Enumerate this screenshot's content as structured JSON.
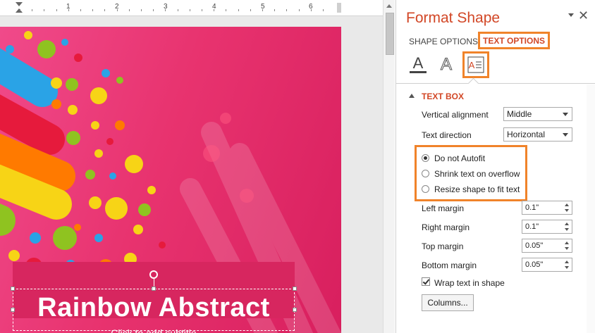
{
  "ruler": {
    "numbers": [
      "1",
      "2",
      "3",
      "4",
      "5",
      "6"
    ]
  },
  "slide": {
    "title": "Rainbow Abstract",
    "subtitle": "Click to add subtitle"
  },
  "pane": {
    "title": "Format Shape",
    "tabs": {
      "shape_options": "SHAPE OPTIONS",
      "text_options": "TEXT OPTIONS"
    },
    "icons": [
      "text-fill-outline-icon",
      "text-effects-icon",
      "textbox-icon"
    ],
    "section": "TEXT BOX",
    "vertical_alignment": {
      "label": "Vertical alignment",
      "value": "Middle"
    },
    "text_direction": {
      "label": "Text direction",
      "value": "Horizontal"
    },
    "autofit": {
      "options": [
        "Do not Autofit",
        "Shrink text on overflow",
        "Resize shape to fit text"
      ],
      "selected": "Do not Autofit"
    },
    "margins": {
      "left": {
        "label": "Left margin",
        "value": "0.1\""
      },
      "right": {
        "label": "Right margin",
        "value": "0.1\""
      },
      "top": {
        "label": "Top margin",
        "value": "0.05\""
      },
      "bottom": {
        "label": "Bottom margin",
        "value": "0.05\""
      }
    },
    "wrap": {
      "label": "Wrap text in shape",
      "checked": true
    },
    "columns_button": "Columns..."
  },
  "colors": {
    "accent": "#d24726",
    "highlight": "#f0832a",
    "slide_bg": "#e8336f"
  }
}
